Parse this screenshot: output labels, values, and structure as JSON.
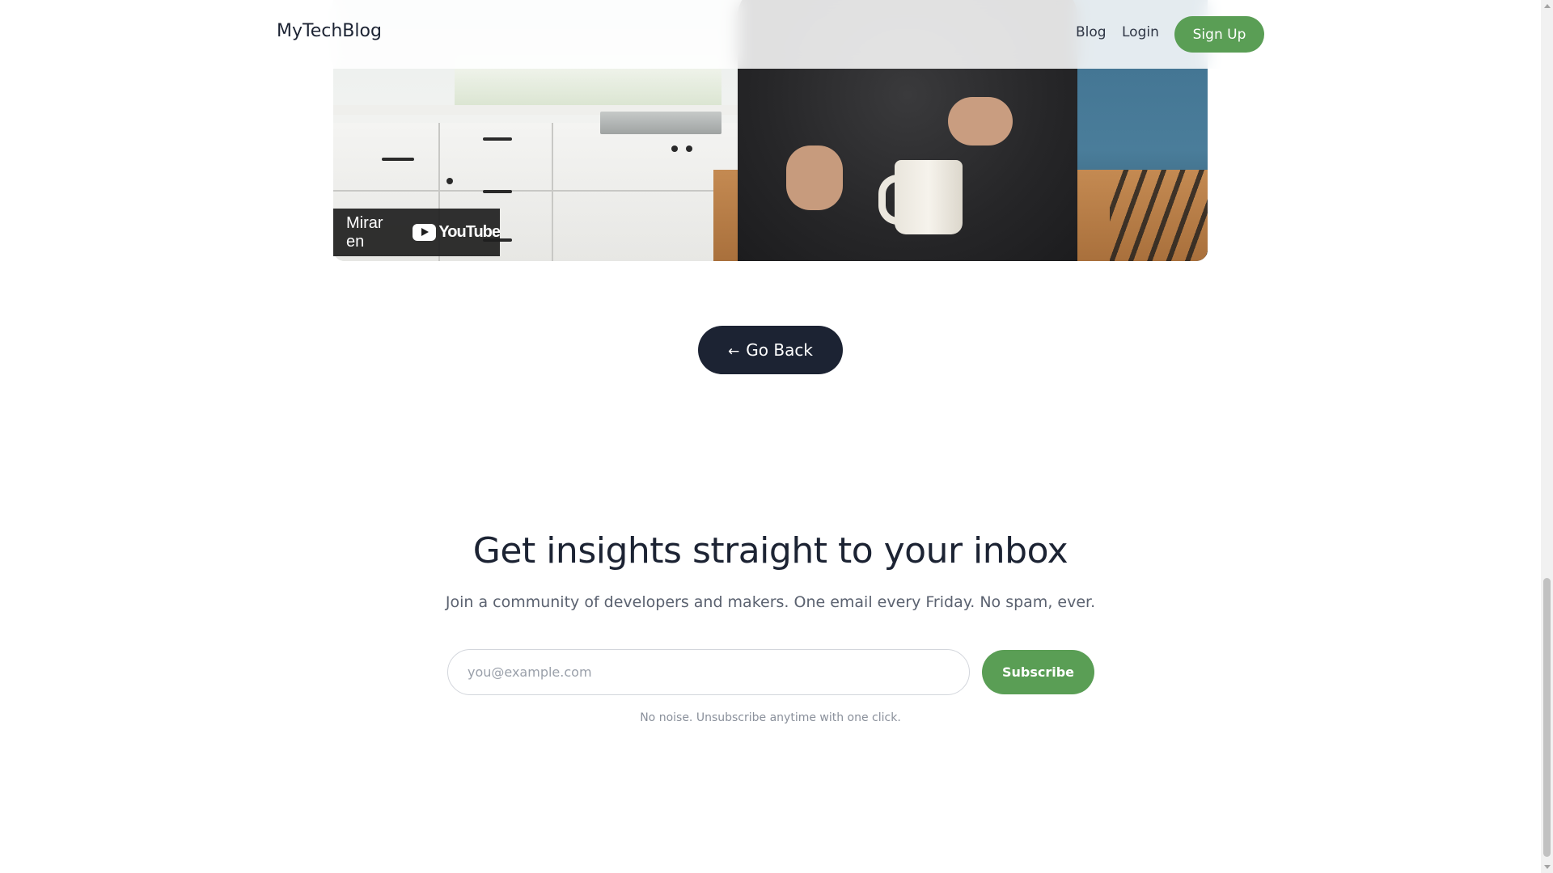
{
  "header": {
    "brand": "MyTechBlog",
    "nav": [
      {
        "label": "Blog"
      },
      {
        "label": "Login"
      }
    ],
    "signup_label": "Sign Up"
  },
  "video": {
    "watch_on_label": "Mirar en",
    "platform_label": "YouTube"
  },
  "go_back": {
    "arrow": "←",
    "label": "Go Back"
  },
  "newsletter": {
    "title": "Get insights straight to your inbox",
    "subtitle": "Join a community of developers and makers. One email every Friday. No spam, ever.",
    "email_placeholder": "you@example.com",
    "email_value": "",
    "subscribe_label": "Subscribe",
    "fineprint": "No noise. Unsubscribe anytime with one click."
  },
  "colors": {
    "accent_green": "#5a9e55",
    "dark_navy": "#1c2333",
    "muted_text": "#5b6270"
  },
  "icons": {
    "youtube": "youtube-logo-icon",
    "back_arrow": "left-arrow-icon"
  }
}
